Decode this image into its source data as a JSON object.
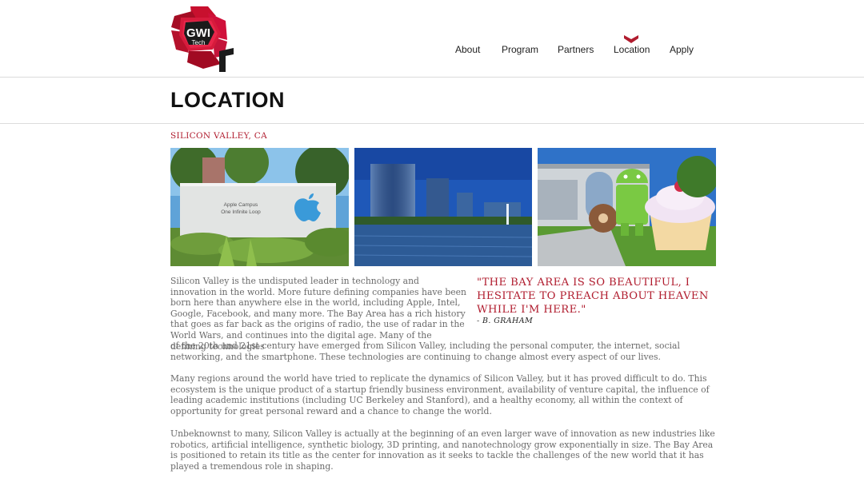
{
  "header": {
    "logo": {
      "line1": "GWI",
      "line2": "Tech"
    },
    "nav": [
      {
        "label": "About"
      },
      {
        "label": "Program"
      },
      {
        "label": "Partners"
      },
      {
        "label": "Location"
      },
      {
        "label": "Apply"
      }
    ],
    "active_nav": "Location"
  },
  "page": {
    "title": "LOCATION",
    "subtitle": "SILICON VALLEY, CA"
  },
  "photos": {
    "apple_sign": {
      "line1": "Apple Campus",
      "line2": "One Infinite Loop"
    }
  },
  "quote": {
    "text": "\"THE BAY AREA IS SO BEAUTIFUL, I HESITATE TO PREACH ABOUT HEAVEN WHILE I'M HERE.\"",
    "author": "- B. GRAHAM"
  },
  "body": {
    "paragraph1_wrapped": "Silicon Valley is the undisputed leader in technology and innovation in the world. More future defining companies have been born here than anywhere else in the world, including Apple, Intel, Google, Facebook, and many more. The Bay Area has a rich history that goes as far back as the origins of radio, the use of radar in the World Wars, and continues into the digital age. Many of the defining technologies",
    "paragraph1_full": "of the 20th and 21st century have emerged from Silicon Valley, including the personal computer, the internet, social networking, and the smartphone. These technologies are continuing to change almost every aspect of our lives.",
    "paragraph2": "Many regions around the world have tried to replicate the dynamics of Silicon Valley, but it has proved difficult to do. This ecosystem is the unique product of a startup friendly business environment, availability of venture capital, the influence of leading academic institutions (including UC Berkeley and Stanford), and a healthy economy, all within the context of opportunity for great personal reward and a chance to change the world.",
    "paragraph3": "Unbeknownst to many, Silicon Valley is actually at the beginning of an even larger wave of innovation as new industries like robotics, artificial intelligence, synthetic biology, 3D printing, and nanotechnology grow exponentially in size. The Bay Area is positioned to retain its title as the center for innovation as it seeks to tackle the challenges of the new world that it has played a tremendous role in shaping."
  },
  "colors": {
    "accent": "#b01c2e",
    "text": "#6a6a6a",
    "nav_text": "#222222"
  }
}
